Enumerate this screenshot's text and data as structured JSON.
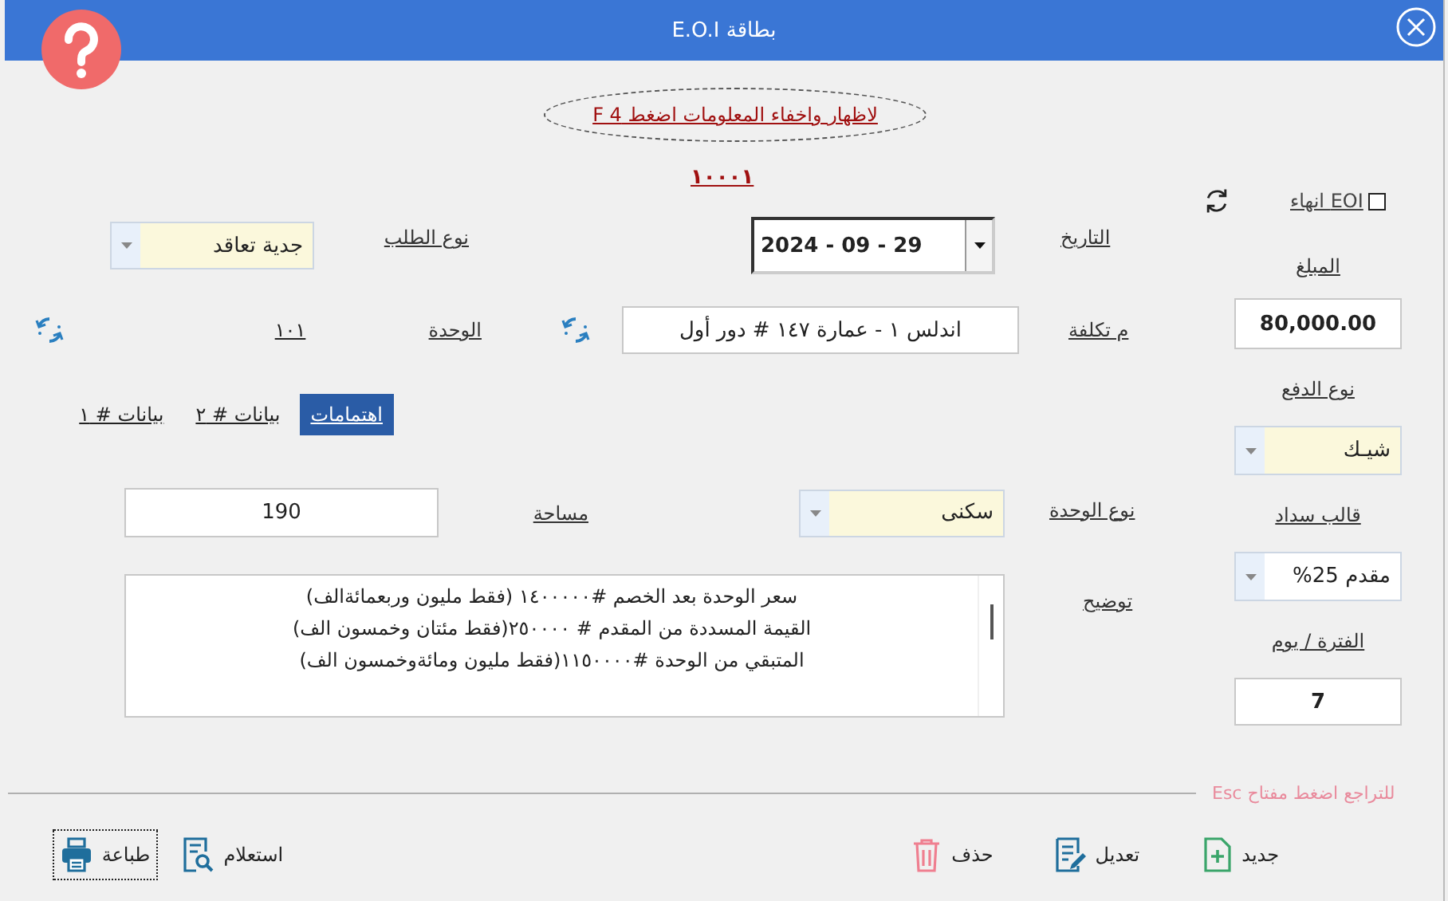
{
  "window": {
    "title": "بطاقة E.O.I"
  },
  "hint": "لاظهار  واخفاء المعلومات اضغط  F 4",
  "code": "١٠٠٠١",
  "request_type": {
    "label": "نوع الطلب",
    "value": "جدية تعاقد"
  },
  "date": {
    "label": "التاريخ",
    "value": "2024 - 09 - 29"
  },
  "unit": {
    "label": "الوحدة",
    "value": "١٠١"
  },
  "cost_center": {
    "label": "م تكلفة",
    "value": "اندلس ١ - عمارة ١٤٧ # دور أول"
  },
  "tabs": [
    {
      "label": "اهتمامات",
      "selected": true
    },
    {
      "label": "بيانات # ٢",
      "selected": false
    },
    {
      "label": "بيانات # ١",
      "selected": false
    }
  ],
  "area": {
    "label": "مساحة",
    "value": "190"
  },
  "unit_type": {
    "label": "نوع الوحدة",
    "value": "سكنى"
  },
  "description": {
    "label": "توضيح",
    "lines": [
      "سعر الوحدة بعد الخصم #١٤٠٠٠٠٠ (فقط مليون وربعمائةالف)",
      "القيمة المسددة من المقدم # ٢٥٠٠٠٠(فقط مئتان وخمسون الف)",
      "المتبقي من الوحدة #١١٥٠٠٠٠(فقط مليون ومائةوخمسون الف)"
    ]
  },
  "eoi": {
    "label": "EOI انهاء",
    "checked": false
  },
  "amount": {
    "label": "المبلغ",
    "value": "80,000.00"
  },
  "payment_type": {
    "label": "نوع الدفع",
    "value": "شيـك"
  },
  "payment_template": {
    "label": "قالب سداد",
    "value": "مقدم 25%"
  },
  "period": {
    "label": "الفترة / يوم",
    "value": "7"
  },
  "undo_hint": "للتراجع اضغط مفتاح Esc",
  "actions": [
    {
      "label": "جديد",
      "kind": "new",
      "focused": false
    },
    {
      "label": "تعديل",
      "kind": "edit",
      "focused": false
    },
    {
      "label": "حذف",
      "kind": "delete",
      "focused": false
    },
    {
      "label": "استعلام",
      "kind": "query",
      "focused": false
    },
    {
      "label": "طباعة",
      "kind": "print",
      "focused": true
    }
  ]
}
